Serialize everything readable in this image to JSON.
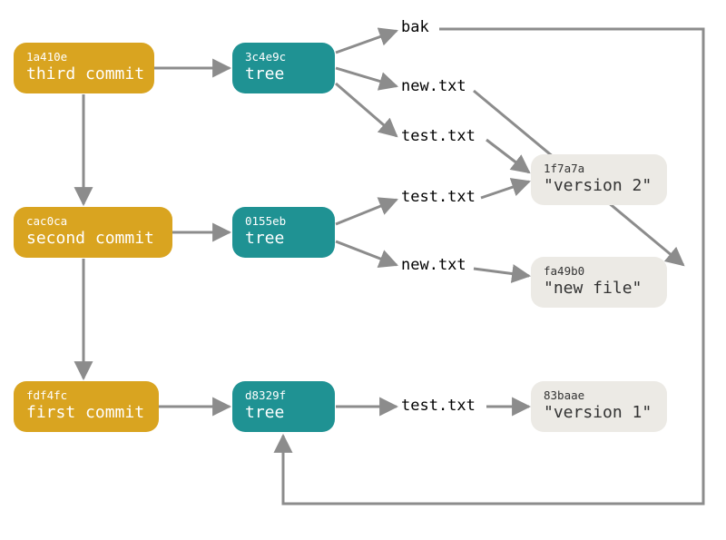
{
  "colors": {
    "commit": "#d9a420",
    "tree": "#1f9293",
    "blob_bg": "#eceae5",
    "edge": "#8c8c8c"
  },
  "commits": [
    {
      "hash": "fdf4fc",
      "label": "first commit",
      "tree": "d8329f",
      "parent": null
    },
    {
      "hash": "cac0ca",
      "label": "second commit",
      "tree": "0155eb",
      "parent": "fdf4fc"
    },
    {
      "hash": "1a410e",
      "label": "third commit",
      "tree": "3c4e9c",
      "parent": "cac0ca"
    }
  ],
  "trees": [
    {
      "hash": "d8329f",
      "label": "tree",
      "entries": [
        {
          "name": "test.txt",
          "target": "83baae",
          "type": "blob"
        }
      ]
    },
    {
      "hash": "0155eb",
      "label": "tree",
      "entries": [
        {
          "name": "test.txt",
          "target": "1f7a7a",
          "type": "blob"
        },
        {
          "name": "new.txt",
          "target": "fa49b0",
          "type": "blob"
        }
      ]
    },
    {
      "hash": "3c4e9c",
      "label": "tree",
      "entries": [
        {
          "name": "bak",
          "target": "d8329f",
          "type": "tree"
        },
        {
          "name": "new.txt",
          "target": "fa49b0",
          "type": "blob"
        },
        {
          "name": "test.txt",
          "target": "1f7a7a",
          "type": "blob"
        }
      ]
    }
  ],
  "blobs": [
    {
      "hash": "1f7a7a",
      "label": "\"version 2\""
    },
    {
      "hash": "fa49b0",
      "label": "\"new file\""
    },
    {
      "hash": "83baae",
      "label": "\"version 1\""
    }
  ],
  "edge_labels": {
    "bak": "bak",
    "new_txt": "new.txt",
    "test_txt": "test.txt"
  }
}
